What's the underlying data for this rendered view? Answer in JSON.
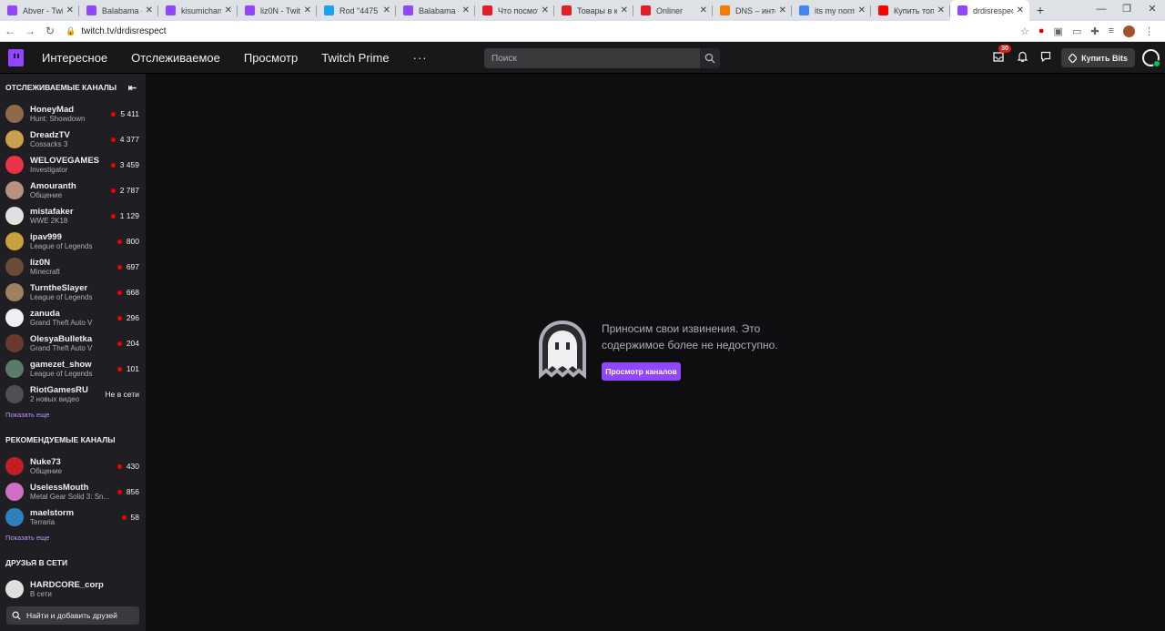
{
  "browser": {
    "tabs": [
      {
        "label": "Abver - Twit",
        "fav_color": "#9147ff"
      },
      {
        "label": "Balabama -",
        "fav_color": "#9147ff"
      },
      {
        "label": "kisumichan -",
        "fav_color": "#9147ff"
      },
      {
        "label": "liz0N - Twitc",
        "fav_color": "#9147ff"
      },
      {
        "label": "Rod \"4475 S",
        "fav_color": "#1da1f2"
      },
      {
        "label": "Balabama -",
        "fav_color": "#9147ff"
      },
      {
        "label": "Что посмот",
        "fav_color": "#e31e24"
      },
      {
        "label": "Товары в ка",
        "fav_color": "#e31e24"
      },
      {
        "label": "Onliner",
        "fav_color": "#e31e24"
      },
      {
        "label": "DNS – интер",
        "fav_color": "#f57c00"
      },
      {
        "label": "its my norm",
        "fav_color": "#4285f4"
      },
      {
        "label": "Купить топо",
        "fav_color": "#ff0000"
      },
      {
        "label": "drdisrespect",
        "fav_color": "#9147ff"
      }
    ],
    "url": "twitch.tv/drdisrespect"
  },
  "topnav": {
    "items": [
      "Интересное",
      "Отслеживаемое",
      "Просмотр",
      "Twitch Prime"
    ],
    "more": "···",
    "search_placeholder": "Поиск",
    "inbox_badge": "30",
    "bits_label": "Купить Bits"
  },
  "sidebar": {
    "followed_title": "ОТСЛЕЖИВАЕМЫЕ КАНАЛЫ",
    "followed": [
      {
        "name": "HoneyMad",
        "game": "Hunt: Showdown",
        "viewers": "5 411",
        "live": true,
        "color": "#8b6b4a"
      },
      {
        "name": "DreadzTV",
        "game": "Cossacks 3",
        "viewers": "4 377",
        "live": true,
        "color": "#c8a050"
      },
      {
        "name": "WELOVEGAMES",
        "game": "Investigator",
        "viewers": "3 459",
        "live": true,
        "color": "#e8334a"
      },
      {
        "name": "Amouranth",
        "game": "Общение",
        "viewers": "2 787",
        "live": true,
        "color": "#b89080"
      },
      {
        "name": "mistafaker",
        "game": "WWE 2K18",
        "viewers": "1 129",
        "live": true,
        "color": "#e0e0e0"
      },
      {
        "name": "ipav999",
        "game": "League of Legends",
        "viewers": "800",
        "live": true,
        "color": "#c9a040"
      },
      {
        "name": "liz0N",
        "game": "Minecraft",
        "viewers": "697",
        "live": true,
        "color": "#6b4a3a"
      },
      {
        "name": "TurntheSlayer",
        "game": "League of Legends",
        "viewers": "668",
        "live": true,
        "color": "#a08060"
      },
      {
        "name": "zanuda",
        "game": "Grand Theft Auto V",
        "viewers": "296",
        "live": true,
        "color": "#f0f0f0"
      },
      {
        "name": "OlesyaBulletka",
        "game": "Grand Theft Auto V",
        "viewers": "204",
        "live": true,
        "color": "#6a3a30"
      },
      {
        "name": "gamezet_show",
        "game": "League of Legends",
        "viewers": "101",
        "live": true,
        "color": "#5a7a6a"
      },
      {
        "name": "RiotGamesRU",
        "game": "2 новых видео",
        "viewers": "Не в сети",
        "live": false,
        "color": "#505050"
      }
    ],
    "show_more": "Показать еще",
    "recommended_title": "РЕКОМЕНДУЕМЫЕ КАНАЛЫ",
    "recommended": [
      {
        "name": "Nuke73",
        "game": "Общение",
        "viewers": "430",
        "live": true,
        "color": "#c02020"
      },
      {
        "name": "UselessMouth",
        "game": "Metal Gear Solid 3: Sn...",
        "viewers": "856",
        "live": true,
        "color": "#d070c0"
      },
      {
        "name": "maelstorm",
        "game": "Terraria",
        "viewers": "58",
        "live": true,
        "color": "#3080c0"
      }
    ],
    "show_more_2": "Показать еще",
    "friends_title": "ДРУЗЬЯ В СЕТИ",
    "friends": [
      {
        "name": "HARDCORE_corp",
        "status": "В сети",
        "color": "#e0e0e0"
      }
    ],
    "friend_search": "Найти и добавить друзей"
  },
  "main": {
    "message_line1": "Приносим свои извинения. Это",
    "message_line2": "содержимое более не недоступно.",
    "browse_button": "Просмотр каналов"
  }
}
